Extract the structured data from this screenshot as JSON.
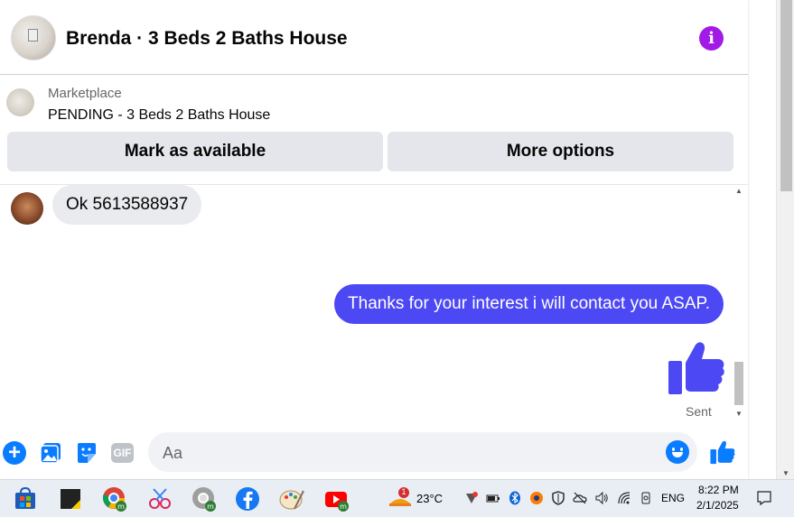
{
  "header": {
    "title": "Brenda · 3 Beds 2 Baths House",
    "info_icon": "i"
  },
  "listing": {
    "label": "Marketplace",
    "status": "PENDING - 3 Beds 2 Baths House",
    "buttons": {
      "mark_available": "Mark as available",
      "more_options": "More options"
    }
  },
  "messages": {
    "incoming": "Ok 5613588937",
    "outgoing": "Thanks for your interest i will contact you ASAP.",
    "status": "Sent"
  },
  "composer": {
    "placeholder": "Aa",
    "value": "",
    "gif_label": "GIF"
  },
  "taskbar": {
    "weather": "23°C",
    "weather_badge": "1",
    "language": "ENG",
    "time": "8:22 PM",
    "date": "2/1/2025"
  },
  "colors": {
    "outgoing_bubble": "#4c48f4",
    "accent_blue": "#0a7cff",
    "info_purple": "#a21ae6",
    "incoming_bubble": "#e9ebee",
    "button_gray": "#e4e6eb"
  },
  "icons": [
    "info-icon",
    "add-icon",
    "photo-icon",
    "sticker-icon",
    "gif-icon",
    "emoji-icon",
    "like-icon",
    "thumbs-up-icon"
  ]
}
